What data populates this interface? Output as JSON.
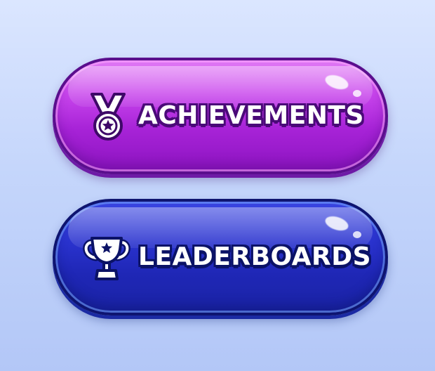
{
  "menu": {
    "buttons": [
      {
        "id": "achievements",
        "label": "ACHIEVEMENTS",
        "icon": "medal-icon",
        "color": "#b02ee0"
      },
      {
        "id": "leaderboards",
        "label": "LEADERBOARDS",
        "icon": "trophy-icon",
        "color": "#2530c4"
      }
    ]
  }
}
